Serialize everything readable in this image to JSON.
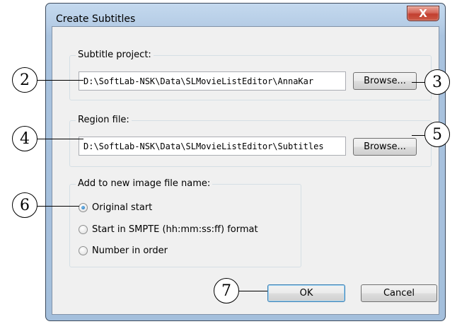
{
  "window": {
    "title": "Create Subtitles",
    "close_glyph": "X",
    "close_color": "#c9463a"
  },
  "subtitle_project": {
    "label": "Subtitle project:",
    "value": "D:\\SoftLab-NSK\\Data\\SLMovieListEditor\\AnnaKar",
    "browse_label": "Browse..."
  },
  "region_file": {
    "label": "Region file:",
    "value": "D:\\SoftLab-NSK\\Data\\SLMovieListEditor\\Subtitles",
    "browse_label": "Browse..."
  },
  "name_options": {
    "label": "Add to new image file name:",
    "options": [
      {
        "label": "Original start",
        "selected": true
      },
      {
        "label": "Start in SMPTE (hh:mm:ss:ff) format",
        "selected": false
      },
      {
        "label": "Number in order",
        "selected": false
      }
    ]
  },
  "buttons": {
    "ok_label": "OK",
    "cancel_label": "Cancel"
  },
  "callouts": [
    "2",
    "3",
    "4",
    "5",
    "6",
    "7"
  ]
}
